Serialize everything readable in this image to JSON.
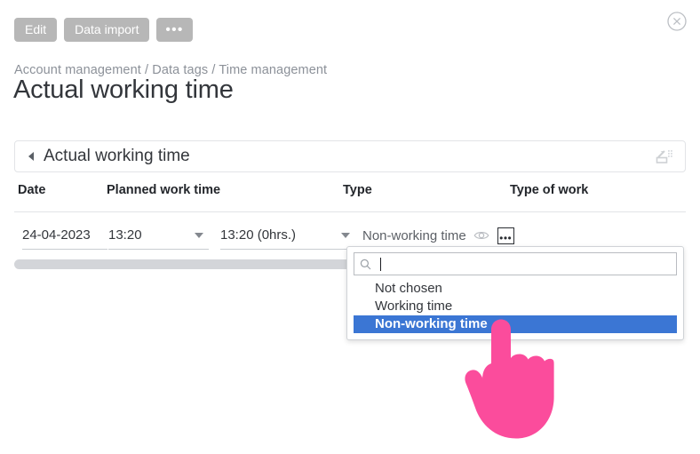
{
  "toolbar": {
    "edit_label": "Edit",
    "data_import_label": "Data import",
    "more_label": "•••"
  },
  "close_button": {
    "name": "close-icon"
  },
  "breadcrumb": {
    "text": "Account management / Data tags / Time management"
  },
  "page": {
    "title": "Actual working time"
  },
  "section": {
    "title": "Actual working time",
    "collapse_state": "expanded",
    "tool_icon": "resize-handle-icon"
  },
  "table": {
    "columns": [
      "Date",
      "Planned work time",
      "Type",
      "Type of work"
    ],
    "rows": [
      {
        "date": "24-04-2023",
        "planned_start": "13:20",
        "planned_end": "13:20 (0hrs.)",
        "type": "Non-working time",
        "type_of_work": ""
      }
    ]
  },
  "dropdown": {
    "search_value": "",
    "search_placeholder": "",
    "options": [
      {
        "label": "Not chosen",
        "selected": false
      },
      {
        "label": "Working time",
        "selected": false
      },
      {
        "label": "Non-working time",
        "selected": true
      }
    ]
  },
  "colors": {
    "accent_blue": "#3b76d4",
    "cursor_pink": "#fb4c9c",
    "button_gray": "#b7b7b7",
    "breadcrumb_gray": "#8c9199",
    "text_dark": "#33363b",
    "border_gray": "#e2e4e7",
    "scrollbar_gray": "#d3d5d9"
  }
}
